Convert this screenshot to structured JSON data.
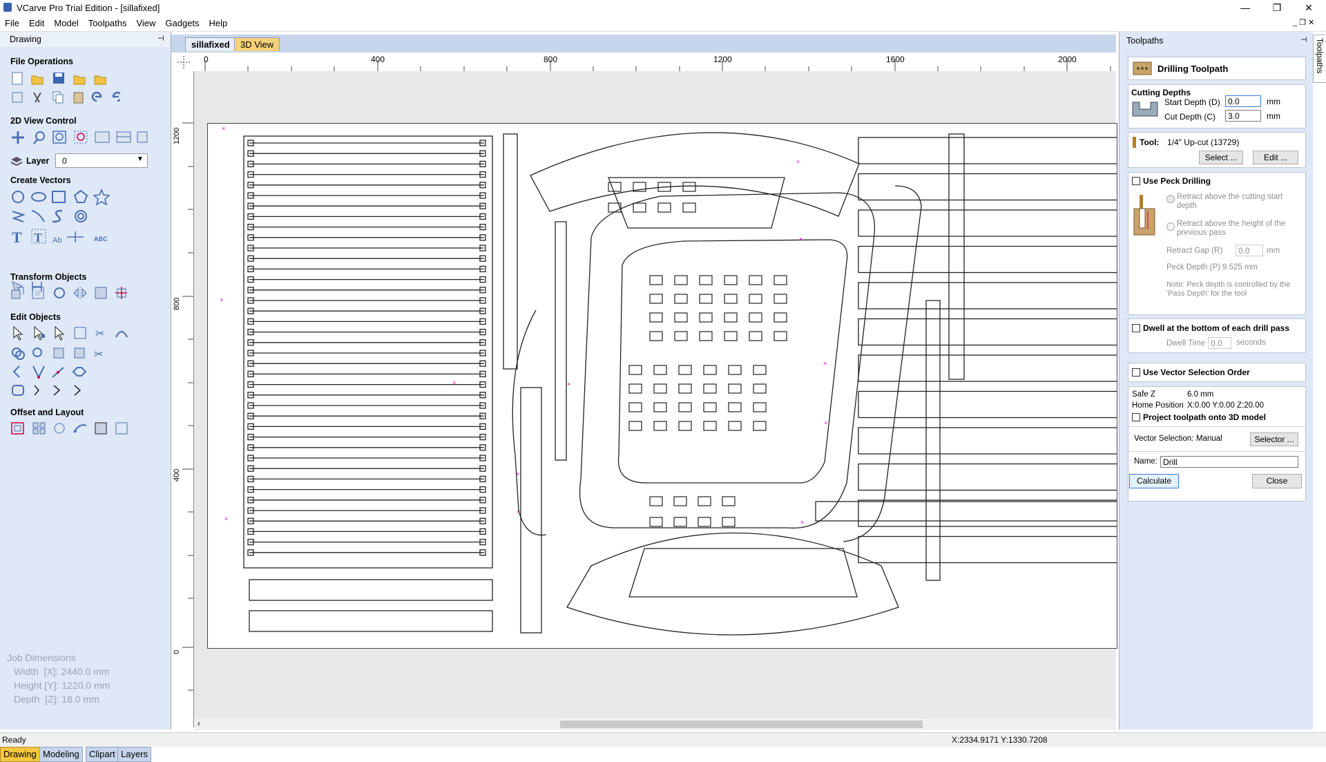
{
  "window": {
    "title": "VCarve Pro Trial Edition - [sillafixed]",
    "minimize": "—",
    "restore": "❐",
    "close": "✕"
  },
  "menu": [
    "File",
    "Edit",
    "Model",
    "Toolpaths",
    "View",
    "Gadgets",
    "Help"
  ],
  "left_panel": {
    "title": "Drawing",
    "sections": {
      "file_ops": "File Operations",
      "view_control": "2D View Control",
      "create_vectors": "Create Vectors",
      "transform": "Transform Objects",
      "edit_objects": "Edit Objects",
      "offset_layout": "Offset and Layout"
    },
    "layer_label": "Layer",
    "layer_value": "0",
    "job_dimensions": {
      "title": "Job Dimensions",
      "width": "Width  [X]: 2440.0 mm",
      "height": "Height [Y]: 1220.0 mm",
      "depth": "Depth  [Z]: 18.0 mm"
    },
    "bottom_tabs": [
      "Drawing",
      "Modeling",
      "Clipart",
      "Layers"
    ]
  },
  "doc_tabs": [
    "sillafixed",
    "3D View"
  ],
  "rulers": {
    "top": [
      "0",
      "400",
      "800",
      "1200",
      "1600",
      "2000"
    ],
    "left": [
      "1200",
      "800",
      "400",
      "0"
    ]
  },
  "right_panel": {
    "title": "Toolpaths",
    "side_tab": "Toolpaths",
    "header": "Drilling Toolpath",
    "cutting_depths": {
      "title": "Cutting Depths",
      "start_label": "Start Depth (D)",
      "start_value": "0.0",
      "cut_label": "Cut Depth (C)",
      "cut_value": "3.0",
      "unit": "mm"
    },
    "tool": {
      "label": "Tool:",
      "value": "1/4\" Up-cut (13729)",
      "select_btn": "Select ...",
      "edit_btn": "Edit ..."
    },
    "peck": {
      "title": "Use Peck Drilling",
      "opt1": "Retract above the cutting start depth",
      "opt2": "Retract above the height of the previous pass",
      "gap_label": "Retract Gap (R)",
      "gap_value": "0.0",
      "gap_unit": "mm",
      "depth_label": "Peck Depth (P)",
      "depth_value": "9.525 mm",
      "note": "Note: Peck depth is controlled by the 'Pass Depth' for the tool"
    },
    "dwell": {
      "title": "Dwell at the bottom of each drill pass",
      "time_label": "Dwell Time",
      "time_value": "0.0",
      "unit": "seconds"
    },
    "vector_order": "Use Vector Selection Order",
    "info": {
      "safe_z_label": "Safe Z",
      "safe_z_value": "6.0 mm",
      "home_label": "Home Position",
      "home_value": "X:0.00 Y:0.00 Z:20.00",
      "project_label": "Project toolpath onto 3D model"
    },
    "vector_selection": {
      "label": "Vector Selection:",
      "value": "Manual",
      "btn": "Selector ..."
    },
    "name": {
      "label": "Name:",
      "value": "Drill"
    },
    "calculate": "Calculate",
    "close": "Close"
  },
  "status": {
    "left": "Ready",
    "coords": "X:2334.9171 Y:1330.7208"
  }
}
